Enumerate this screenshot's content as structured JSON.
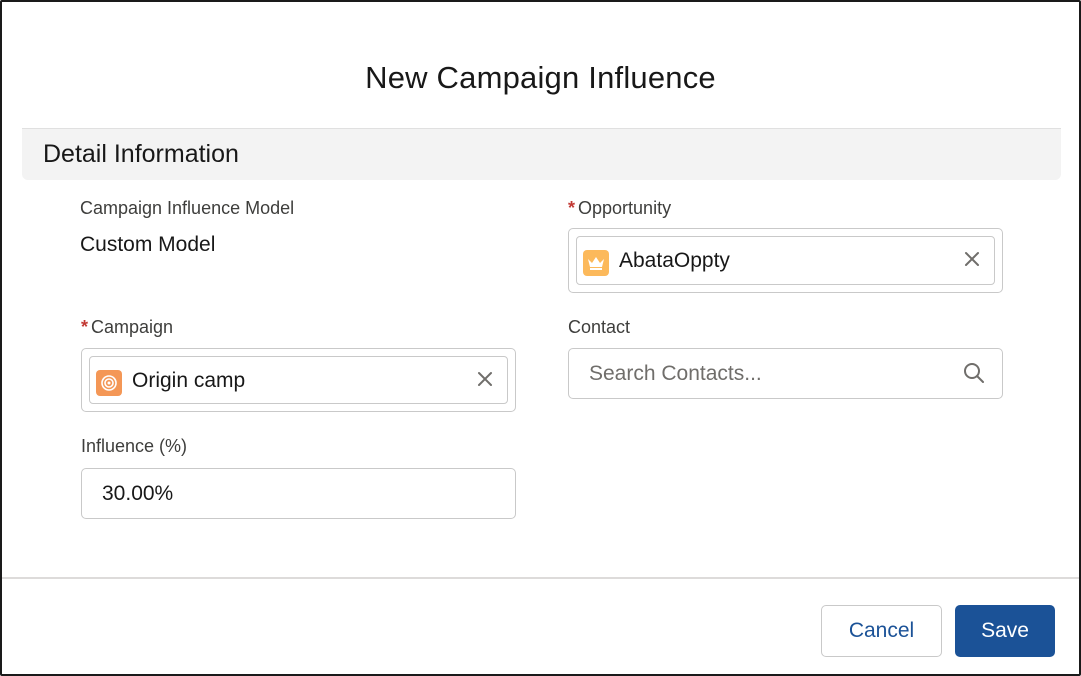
{
  "modal": {
    "title": "New Campaign Influence"
  },
  "section": {
    "title": "Detail Information"
  },
  "fields": {
    "model": {
      "label": "Campaign Influence Model",
      "value": "Custom Model"
    },
    "opportunity": {
      "required_mark": "*",
      "label": "Opportunity",
      "value": "AbataOppty",
      "icon": "opportunity-crown-icon",
      "icon_color": "#fcb95b"
    },
    "campaign": {
      "required_mark": "*",
      "label": "Campaign",
      "value": "Origin camp",
      "icon": "campaign-target-icon",
      "icon_color": "#f49756"
    },
    "contact": {
      "label": "Contact",
      "placeholder": "Search Contacts...",
      "value": ""
    },
    "influence": {
      "label": "Influence (%)",
      "value": "30.00%"
    }
  },
  "footer": {
    "cancel_label": "Cancel",
    "save_label": "Save"
  },
  "colors": {
    "brand": "#1b5297",
    "required": "#c23934",
    "section_bg": "#f3f3f3"
  }
}
